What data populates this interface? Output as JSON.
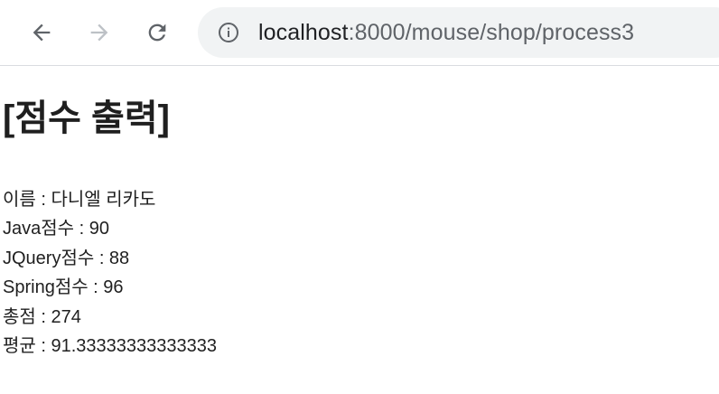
{
  "browser": {
    "url_host": "localhost",
    "url_path": ":8000/mouse/shop/process3",
    "icons": {
      "back": "arrow-left-icon",
      "forward": "arrow-right-icon",
      "reload": "reload-icon",
      "info": "info-icon"
    }
  },
  "page": {
    "title": "[점수 출력]",
    "lines": [
      "이름 : 다니엘 리카도",
      "Java점수 : 90",
      "JQuery점수 : 88",
      "Spring점수 : 96",
      "총점 : 274",
      "평균 : 91.33333333333333"
    ]
  }
}
